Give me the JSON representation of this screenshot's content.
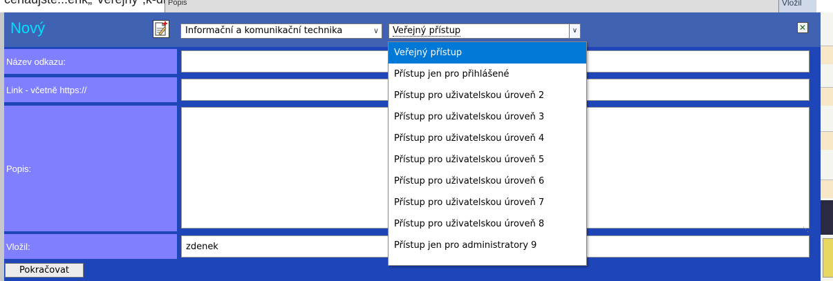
{
  "background": {
    "header_text": "čenaujstě...enk„\"Veřejný\",k-dl ...",
    "popis_label": "Popis",
    "vlozil_label": "Vložil"
  },
  "form": {
    "title": "Nový",
    "category_select": {
      "value": "Informační a komunikační technika"
    },
    "access_select": {
      "value": "Veřejný přístup"
    },
    "close_icon": "close-icon",
    "new_icon": "new-document-icon",
    "fields": {
      "name_label": "Název odkazu:",
      "name_value": "",
      "link_label": "Link - včetně https://",
      "link_value": "",
      "description_label": "Popis:",
      "description_value": "",
      "author_label": "Vložil:",
      "author_value": "zdenek"
    },
    "submit_label": "Pokračovat"
  },
  "access_dropdown": {
    "options": [
      "Veřejný přístup",
      "Přístup jen pro přihlášené",
      "Přístup pro uživatelskou úroveň 2",
      "Přístup pro uživatelskou úroveň 3",
      "Přístup pro uživatelskou úroveň 4",
      "Přístup pro uživatelskou úroveň 5",
      "Přístup pro uživatelskou úroveň 6",
      "Přístup pro uživatelskou úroveň 7",
      "Přístup pro uživatelskou úroveň 8",
      "Přístup jen pro administratory 9"
    ],
    "selected_index": 0
  },
  "colors": {
    "panel": "#1f46b8",
    "titlebar": "#3f62b2",
    "title": "#00e0ff",
    "label_bg": "#8080ff",
    "highlight": "#0078d7"
  }
}
